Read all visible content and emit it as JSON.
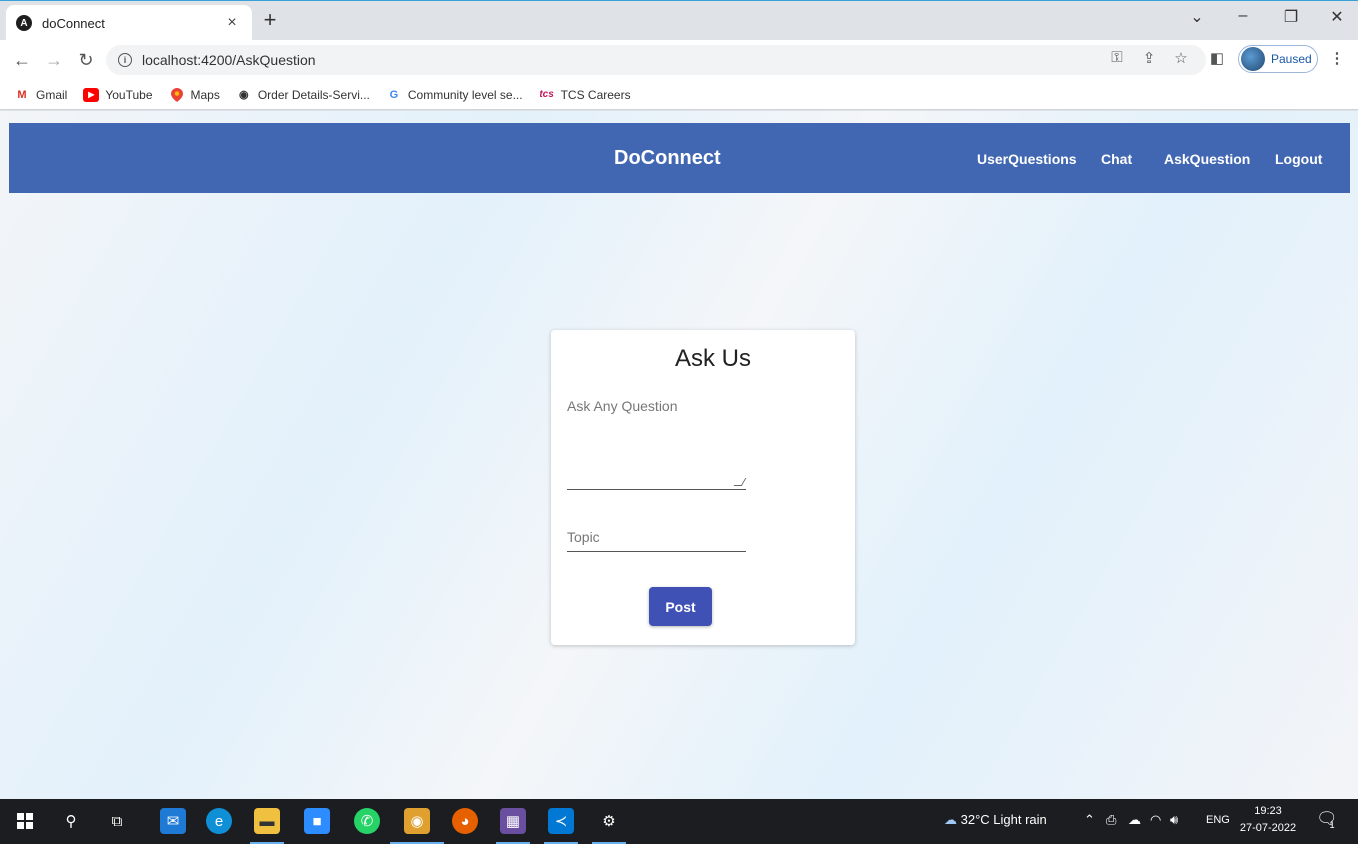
{
  "browser": {
    "tab_title": "doConnect",
    "tab_favicon": "A",
    "tab_close": "×",
    "new_tab": "+",
    "url": "localhost:4200/AskQuestion",
    "profile_status": "Paused",
    "window_controls": {
      "dropdown": "⌄",
      "minimize": "–",
      "restore": "❐",
      "close": "✕"
    }
  },
  "bookmarks": [
    {
      "label": "Gmail",
      "icon": "gmail-icon",
      "glyph": "M",
      "color": "#d93025"
    },
    {
      "label": "YouTube",
      "icon": "youtube-icon",
      "glyph": "▶",
      "color": "#ff0000"
    },
    {
      "label": "Maps",
      "icon": "maps-icon",
      "glyph": "⬤",
      "color": "#34a853"
    },
    {
      "label": "Order Details-Servi...",
      "icon": "globe-icon",
      "glyph": "◉",
      "color": "#333333"
    },
    {
      "label": "Community level se...",
      "icon": "google-icon",
      "glyph": "G",
      "color": "#4285f4"
    },
    {
      "label": "TCS Careers",
      "icon": "tcs-icon",
      "glyph": "tcs",
      "color": "#c2185b"
    }
  ],
  "app": {
    "brand": "DoConnect",
    "nav": {
      "user_questions": "UserQuestions",
      "chat": "Chat",
      "ask_question": "AskQuestion",
      "logout": "Logout"
    },
    "colors": {
      "navbar": "#4267b2",
      "button": "#3f51b5"
    }
  },
  "form": {
    "title": "Ask Us",
    "question_label": "Ask Any Question",
    "question_value": "",
    "topic_label": "Topic",
    "topic_value": "",
    "post_label": "Post"
  },
  "taskbar": {
    "weather": "32°C  Light rain",
    "language": "ENG",
    "time": "19:23",
    "date": "27-07-2022",
    "notification_count": "1"
  }
}
